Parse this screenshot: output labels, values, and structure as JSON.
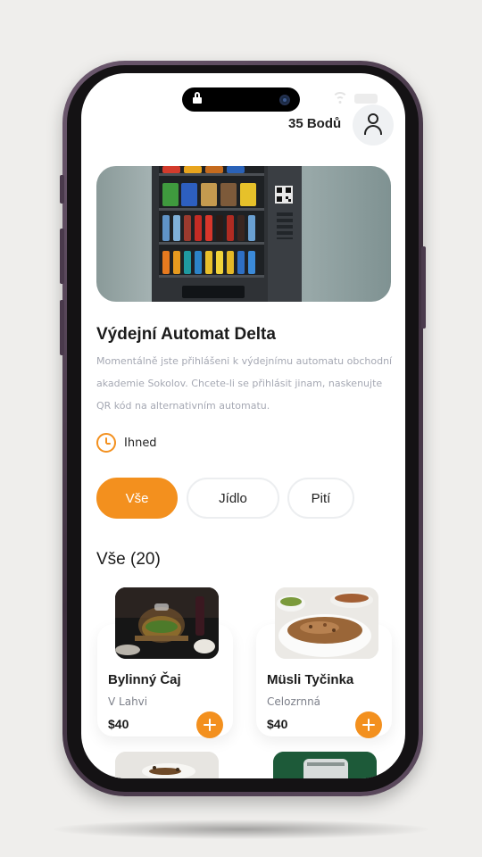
{
  "status_bar": {
    "wifi_icon": "wifi-icon",
    "battery_icon": "battery-icon",
    "lock_icon": "lock-icon"
  },
  "header": {
    "points_label": "35 Bodů",
    "profile_icon": "user-icon"
  },
  "machine": {
    "name": "Výdejní Automat Delta",
    "description": "Momentálně jste přihlášeni k výdejnímu automatu obchodní akademie Sokolov. Chcete-li se přihlásit jinam, naskenujte QR kód na alternativním automatu.",
    "availability": "Ihned",
    "availability_icon": "clock-icon"
  },
  "filters": [
    {
      "label": "Vše",
      "active": true
    },
    {
      "label": "Jídlo",
      "active": false
    },
    {
      "label": "Pití",
      "active": false
    }
  ],
  "section": {
    "title": "Vše (20)"
  },
  "products": [
    {
      "name": "Bylinný Čaj",
      "subtitle": "V Lahvi",
      "price": "$40"
    },
    {
      "name": "Müsli Tyčinka",
      "subtitle": "Celozrnná",
      "price": "$40"
    }
  ],
  "colors": {
    "accent": "#f3901e",
    "text": "#1b1b1b",
    "muted": "#a5a8b3"
  }
}
